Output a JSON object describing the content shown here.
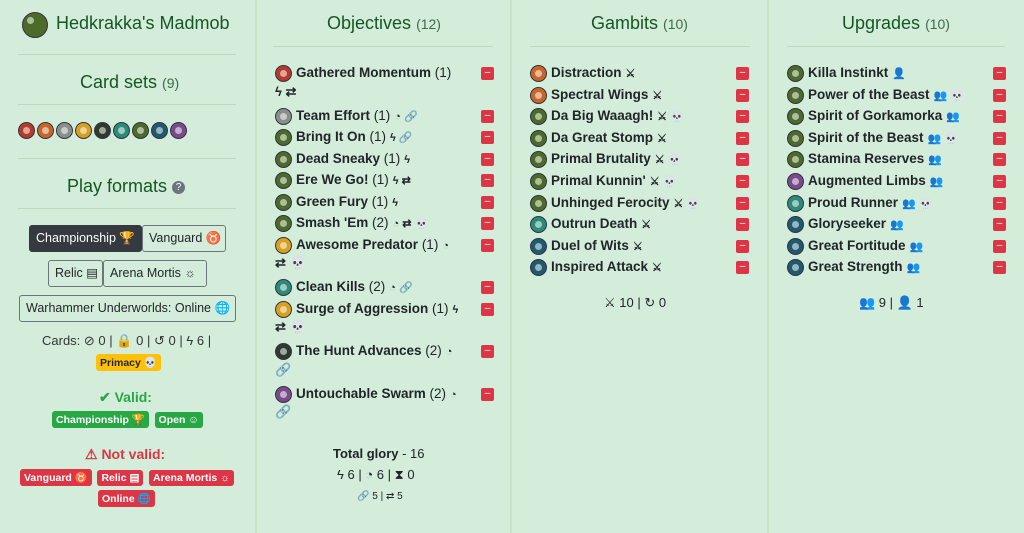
{
  "deck": {
    "name": "Hedkrakka's Madmob"
  },
  "card_sets": {
    "title": "Card sets",
    "count": "(9)",
    "icon_colors": [
      "#b53a2a",
      "#c8662a",
      "#8a8f88",
      "#d8a020",
      "#2d3a2d",
      "#2c8a78",
      "#4c6b2a",
      "#1f5a6e",
      "#7a4a8a"
    ]
  },
  "play_formats": {
    "title": "Play formats",
    "help_icon": "?",
    "buttons": {
      "championship": "Championship 🏆",
      "vanguard": "Vanguard ♉",
      "relic": "Relic ▤",
      "arena_mortis": "Arena Mortis ☼",
      "online": "Warhammer Underworlds: Online 🌐"
    }
  },
  "card_stats": {
    "label": "Cards:",
    "banned": "⊘ 0",
    "restricted": "🔒 0",
    "rotated": "↺ 0",
    "surge": "ϟ 6",
    "sep": "|"
  },
  "primacy_badge": "Primacy 💀",
  "valid": {
    "title": "✔ Valid:",
    "badges": [
      "Championship 🏆",
      "Open ☺"
    ]
  },
  "not_valid": {
    "title": "⚠ Not valid:",
    "badges_row1": [
      "Vanguard ♉",
      "Relic ▤",
      "Arena Mortis ☼"
    ],
    "badges_row2": [
      "Online 🌐"
    ]
  },
  "objectives": {
    "title": "Objectives",
    "count": "(12)",
    "items": [
      {
        "name": "Gathered Momentum",
        "count": " (1)",
        "tags": "",
        "tags2": "ϟ ⇄",
        "color": "#b53a2a"
      },
      {
        "name": "Team Effort",
        "count": " (1)",
        "tags": "◔ 🔗",
        "color": "#8a8f88"
      },
      {
        "name": "Bring It On",
        "count": " (1)",
        "tags": "ϟ 🔗",
        "color": "#4c6b2a"
      },
      {
        "name": "Dead Sneaky",
        "count": " (1)",
        "tags": "ϟ",
        "color": "#4c6b2a"
      },
      {
        "name": "Ere We Go!",
        "count": " (1)",
        "tags": "ϟ ⇄",
        "color": "#4c6b2a"
      },
      {
        "name": "Green Fury",
        "count": " (1)",
        "tags": "ϟ",
        "color": "#4c6b2a"
      },
      {
        "name": "Smash 'Em",
        "count": " (2)",
        "tags": "◔ ⇄ 💀",
        "color": "#4c6b2a"
      },
      {
        "name": "Awesome Predator",
        "count": " (1)",
        "tags": "◔",
        "tags2": "⇄ 💀",
        "color": "#d8a020"
      },
      {
        "name": "Clean Kills",
        "count": " (2)",
        "tags": "◔ 🔗",
        "color": "#2c8a78"
      },
      {
        "name": "Surge of Aggression",
        "count": " (1)",
        "tags": "ϟ",
        "tags2": "⇄ 💀",
        "color": "#d8a020"
      },
      {
        "name": "The Hunt Advances",
        "count": " (2)",
        "tags": "◔",
        "tags2": "🔗",
        "color": "#2d3a2d"
      },
      {
        "name": "Untouchable Swarm",
        "count": " (2)",
        "tags": "◔",
        "tags2": "🔗",
        "color": "#7a4a8a"
      }
    ],
    "total_glory_label": "Total glory",
    "total_glory_value": " - 16",
    "summary": "ϟ 6 | ◔ 6 | ⧗ 0",
    "summary2": "🔗 5 | ⇄ 5"
  },
  "gambits": {
    "title": "Gambits",
    "count": "(10)",
    "items": [
      {
        "name": "Distraction",
        "tags": "⚔",
        "color": "#c8662a"
      },
      {
        "name": "Spectral Wings",
        "tags": "⚔",
        "color": "#c8662a"
      },
      {
        "name": "Da Big Waaagh!",
        "tags": "⚔ 💀",
        "color": "#4c6b2a"
      },
      {
        "name": "Da Great Stomp",
        "tags": "⚔",
        "color": "#4c6b2a"
      },
      {
        "name": "Primal Brutality",
        "tags": "⚔ 💀",
        "color": "#4c6b2a"
      },
      {
        "name": "Primal Kunnin'",
        "tags": "⚔ 💀",
        "color": "#4c6b2a"
      },
      {
        "name": "Unhinged Ferocity",
        "tags": "⚔ 💀",
        "color": "#4c6b2a"
      },
      {
        "name": "Outrun Death",
        "tags": "⚔",
        "color": "#2c8a78"
      },
      {
        "name": "Duel of Wits",
        "tags": "⚔",
        "color": "#1f5a6e"
      },
      {
        "name": "Inspired Attack",
        "tags": "⚔",
        "color": "#1f5a6e"
      }
    ],
    "summary": "⚔ 10 | ↻ 0"
  },
  "upgrades": {
    "title": "Upgrades",
    "count": "(10)",
    "items": [
      {
        "name": "Killa Instinkt",
        "tags": "👤",
        "color": "#4c6b2a"
      },
      {
        "name": "Power of the Beast",
        "tags": "👥 💀",
        "color": "#4c6b2a"
      },
      {
        "name": "Spirit of Gorkamorka",
        "tags": "👥",
        "color": "#4c6b2a"
      },
      {
        "name": "Spirit of the Beast",
        "tags": "👥 💀",
        "color": "#4c6b2a"
      },
      {
        "name": "Stamina Reserves",
        "tags": "👥",
        "color": "#4c6b2a"
      },
      {
        "name": "Augmented Limbs",
        "tags": "👥",
        "color": "#7a4a8a"
      },
      {
        "name": "Proud Runner",
        "tags": "👥 💀",
        "color": "#2c8a78"
      },
      {
        "name": "Gloryseeker",
        "tags": "👥",
        "color": "#1f5a6e"
      },
      {
        "name": "Great Fortitude",
        "tags": "👥",
        "color": "#1f5a6e"
      },
      {
        "name": "Great Strength",
        "tags": "👥",
        "color": "#1f5a6e"
      }
    ],
    "summary": "👥 9 | 👤 1"
  },
  "delete_label": "–"
}
